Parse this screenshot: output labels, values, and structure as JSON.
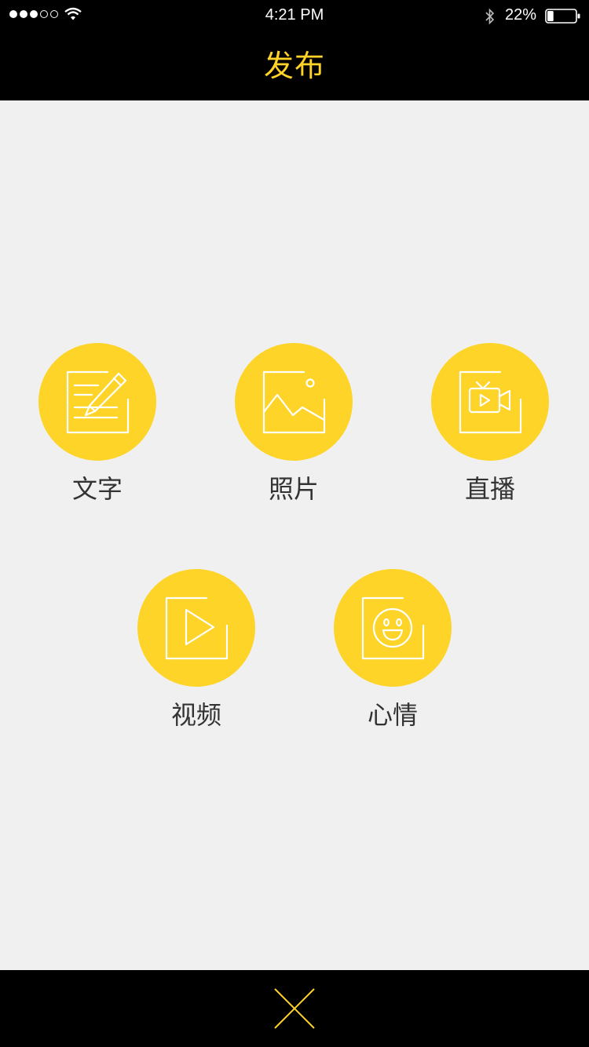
{
  "status_bar": {
    "time": "4:21 PM",
    "battery_percent": "22%",
    "battery_level": 0.22,
    "signal_bars": 3,
    "signal_total": 5
  },
  "header": {
    "title": "发布"
  },
  "menu": {
    "items": [
      {
        "label": "文字",
        "icon": "edit-text-icon"
      },
      {
        "label": "照片",
        "icon": "photo-icon"
      },
      {
        "label": "直播",
        "icon": "live-camera-icon"
      },
      {
        "label": "视频",
        "icon": "video-play-icon"
      },
      {
        "label": "心情",
        "icon": "mood-smiley-icon"
      }
    ]
  },
  "footer": {
    "close_icon": "close-icon"
  },
  "colors": {
    "accent": "#ffd327",
    "circle": "#fdd427",
    "bar_background": "#000000",
    "page_background": "#f0f0f0",
    "label_text": "#333333"
  }
}
